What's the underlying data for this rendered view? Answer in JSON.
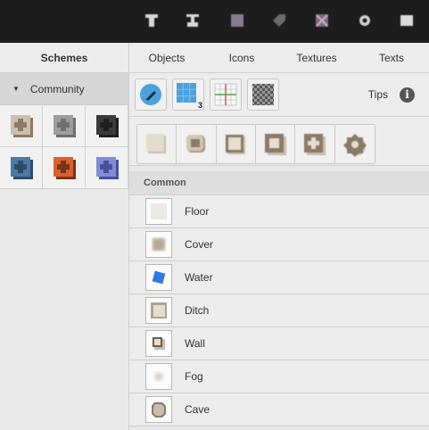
{
  "toolbar": {
    "tools": [
      {
        "icon": "text-tool-icon"
      },
      {
        "icon": "text-alt-tool-icon"
      },
      {
        "icon": "square-tool-icon"
      },
      {
        "icon": "tag-tool-icon"
      },
      {
        "icon": "grid-cross-tool-icon"
      },
      {
        "icon": "gear-tool-icon"
      },
      {
        "icon": "window-tool-icon"
      }
    ]
  },
  "left": {
    "header": "Schemes",
    "group_label": "Community",
    "schemes": [
      {
        "icon": "scheme-beige-icon",
        "fill": "#cbbfae",
        "shade": "#8b7a68"
      },
      {
        "icon": "scheme-grey-icon",
        "fill": "#9c9c9c",
        "shade": "#6f6f6f"
      },
      {
        "icon": "scheme-dark-icon",
        "fill": "#3b3b3b",
        "shade": "#1f1f1f"
      },
      {
        "icon": "scheme-blue-icon",
        "fill": "#4a7aa8",
        "shade": "#2e4b66"
      },
      {
        "icon": "scheme-orange-icon",
        "fill": "#d9622b",
        "shade": "#7a331a"
      },
      {
        "icon": "scheme-lightblue-icon",
        "fill": "#7d8ed6",
        "shade": "#4a4f9a"
      }
    ]
  },
  "tabs": [
    "Objects",
    "Icons",
    "Textures",
    "Texts"
  ],
  "tools": {
    "grid_badge": "3",
    "tips_label": "Tips",
    "info_label": "i"
  },
  "shapes": [
    {
      "icon": "shape-flat-icon"
    },
    {
      "icon": "shape-rough-icon"
    },
    {
      "icon": "shape-square-outline-icon"
    },
    {
      "icon": "shape-square-thick-icon"
    },
    {
      "icon": "shape-cross-icon"
    },
    {
      "icon": "shape-flower-icon"
    }
  ],
  "section": {
    "title": "Common",
    "items": [
      {
        "label": "Floor",
        "icon": "floor-icon"
      },
      {
        "label": "Cover",
        "icon": "cover-icon"
      },
      {
        "label": "Water",
        "icon": "water-icon"
      },
      {
        "label": "Ditch",
        "icon": "ditch-icon"
      },
      {
        "label": "Wall",
        "icon": "wall-icon"
      },
      {
        "label": "Fog",
        "icon": "fog-icon"
      },
      {
        "label": "Cave",
        "icon": "cave-icon"
      }
    ]
  },
  "colors": {
    "accent_blue": "#4aa3df",
    "brown": "#8b7a68",
    "water": "#2f7be0"
  }
}
